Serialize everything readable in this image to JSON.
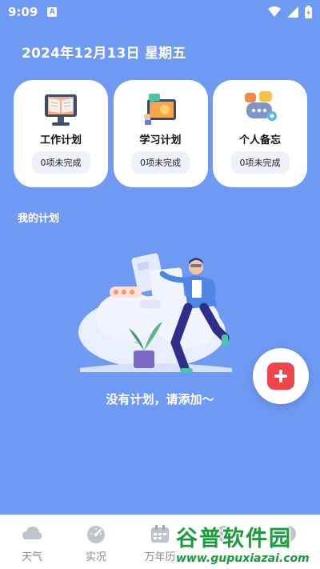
{
  "status_bar": {
    "time": "9:09",
    "sim_badge": "A"
  },
  "header": {
    "date": "2024年12月13日 星期五"
  },
  "cards": [
    {
      "title": "工作计划",
      "badge": "0项未完成"
    },
    {
      "title": "学习计划",
      "badge": "0项未完成"
    },
    {
      "title": "个人备忘",
      "badge": "0项未完成"
    }
  ],
  "section": {
    "title": "我的计划"
  },
  "empty_state": {
    "text": "没有计划，请添加～"
  },
  "fab": {
    "icon": "plus-icon"
  },
  "tabbar": [
    {
      "label": "天气",
      "icon": "cloud-icon"
    },
    {
      "label": "实况",
      "icon": "gauge-icon"
    },
    {
      "label": "万年历",
      "icon": "calendar-icon"
    },
    {
      "label": "",
      "icon": "tab-icon-4"
    },
    {
      "label": "",
      "icon": "tab-icon-5"
    }
  ],
  "watermark": {
    "title": "谷普软件园",
    "url": "www.gupuxiazai.com"
  },
  "colors": {
    "background": "#6f9af3",
    "fab_accent": "#f0434a",
    "watermark": "#1a9c3a"
  }
}
